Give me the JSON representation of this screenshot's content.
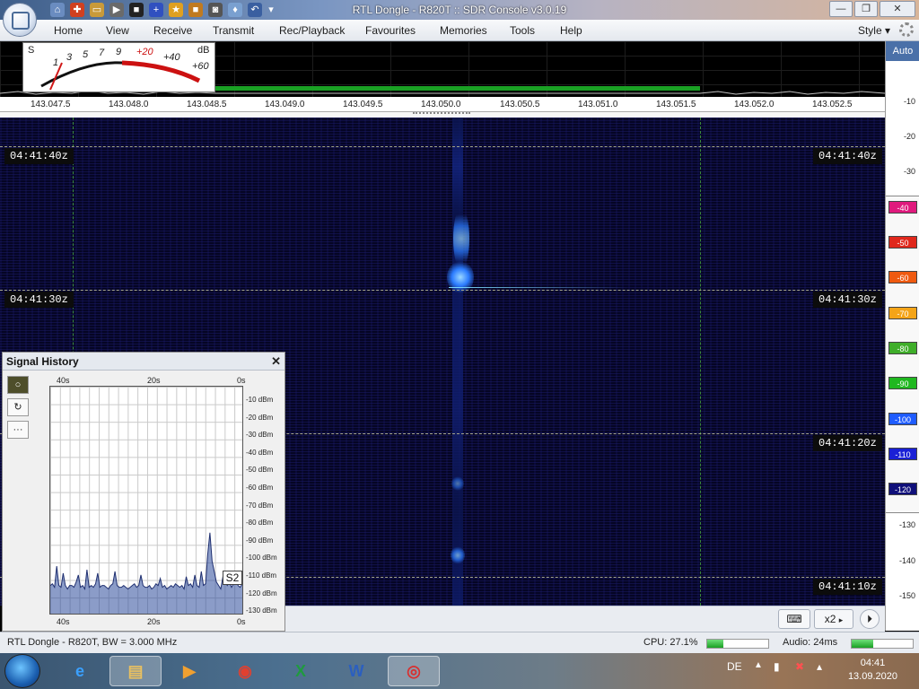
{
  "window": {
    "title": "RTL Dongle - R820T :: SDR Console v3.0.19",
    "buttons": {
      "minimize": "—",
      "restore": "❐",
      "close": "✕"
    }
  },
  "ribbon": {
    "tabs": [
      "Home",
      "View",
      "Receive",
      "Transmit",
      "Rec/Playback",
      "Favourites",
      "Memories",
      "Tools",
      "Help"
    ],
    "style_label": "Style ▾"
  },
  "smeter": {
    "s_label": "S",
    "db_label": "dB",
    "scale": [
      "1",
      "3",
      "5",
      "7",
      "9",
      "+20",
      "+40",
      "+60"
    ]
  },
  "frequency_axis": [
    "143.047.5",
    "143.048.0",
    "143.048.5",
    "143.049.0",
    "143.049.5",
    "143.050.0",
    "143.050.5",
    "143.051.0",
    "143.051.5",
    "143.052.0",
    "143.052.5"
  ],
  "waterfall": {
    "time_labels": [
      "04:41:40z",
      "04:41:30z",
      "04:41:20z",
      "04:41:10z"
    ]
  },
  "color_scale": {
    "auto_label": "Auto",
    "ticks": [
      "-10",
      "-20",
      "-30",
      "-40",
      "-50",
      "-60",
      "-70",
      "-80",
      "-90",
      "-100",
      "-110",
      "-120",
      "-130",
      "-140",
      "-150"
    ],
    "colors": {
      "-40": "#e0197d",
      "-50": "#e0281c",
      "-60": "#ef5a10",
      "-70": "#f4a418",
      "-80": "#3fae2a",
      "-90": "#20b820",
      "-100": "#1f5cff",
      "-110": "#1a20d6",
      "-120": "#10107a"
    }
  },
  "bottom_toolbar": {
    "keyboard_icon": "⌨",
    "zoom_label": "x2",
    "play_icon": "▸"
  },
  "signal_history": {
    "title": "Signal History",
    "close": "✕",
    "tools": [
      "○",
      "↻",
      "···"
    ],
    "x_axis": [
      "40s",
      "20s",
      "0s"
    ],
    "y_axis": [
      "-10 dBm",
      "-20 dBm",
      "-30 dBm",
      "-40 dBm",
      "-50 dBm",
      "-60 dBm",
      "-70 dBm",
      "-80 dBm",
      "-90 dBm",
      "-100 dBm",
      "-110 dBm",
      "-120 dBm",
      "-130 dBm"
    ],
    "s_value": "S2",
    "trace_dbm": [
      -118,
      -117,
      -119,
      -107,
      -118,
      -119,
      -111,
      -118,
      -120,
      -118,
      -118,
      -119,
      -116,
      -112,
      -119,
      -118,
      -120,
      -109,
      -119,
      -118,
      -119,
      -117,
      -111,
      -119,
      -118,
      -118,
      -119,
      -120,
      -118,
      -117,
      -110,
      -118,
      -119,
      -119,
      -118,
      -119,
      -120,
      -119,
      -118,
      -117,
      -119,
      -118,
      -112,
      -118,
      -119,
      -119,
      -118,
      -120,
      -119,
      -117,
      -118,
      -114,
      -119,
      -118,
      -120,
      -119,
      -118,
      -119,
      -117,
      -118,
      -119,
      -118,
      -120,
      -113,
      -118,
      -117,
      -119,
      -112,
      -118,
      -119,
      -110,
      -118,
      -117,
      -100,
      -88,
      -104,
      -110,
      -116,
      -118,
      -120,
      -113,
      -115,
      -118,
      -116,
      -119,
      -117,
      -112,
      -118,
      -119,
      -117
    ]
  },
  "status": {
    "device": "RTL Dongle - R820T, BW = 3.000 MHz",
    "cpu": "CPU: 27.1%",
    "cpu_load": 0.27,
    "audio": "Audio: 24ms",
    "audio_level": 0.35
  },
  "taskbar": {
    "language": "DE",
    "time": "04:41",
    "date": "13.09.2020"
  }
}
